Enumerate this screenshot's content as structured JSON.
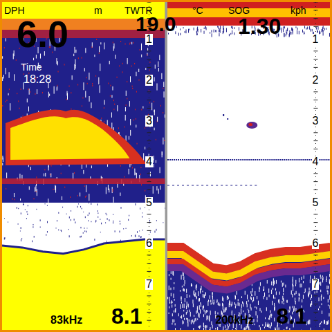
{
  "depth": {
    "label": "DPH",
    "value": "6.0",
    "unit": "m"
  },
  "water_temp": {
    "label": "TWTR",
    "value": "19.0",
    "unit": "°C"
  },
  "speed": {
    "label": "SOG",
    "value": "1.30",
    "unit": "kph"
  },
  "time": {
    "label": "Time",
    "value": "18:28"
  },
  "panels": [
    {
      "frequency": "83kHz",
      "range": "8.1",
      "scale": [
        "1",
        "2",
        "3",
        "4",
        "5",
        "6",
        "7"
      ],
      "bottom_depth": [
        6.05,
        6.1,
        6.2,
        6.25,
        6.15,
        6.0,
        5.95,
        5.9,
        5.9
      ]
    },
    {
      "frequency": "200kHz",
      "range": "8.1",
      "scale": [
        "1",
        "2",
        "3",
        "4",
        "5",
        "6",
        "7"
      ],
      "bottom_depth": [
        6.0,
        6.0,
        6.25,
        6.5,
        6.55,
        6.45,
        6.25,
        6.15,
        6.1,
        6.1,
        6.05,
        6.0
      ]
    }
  ]
}
